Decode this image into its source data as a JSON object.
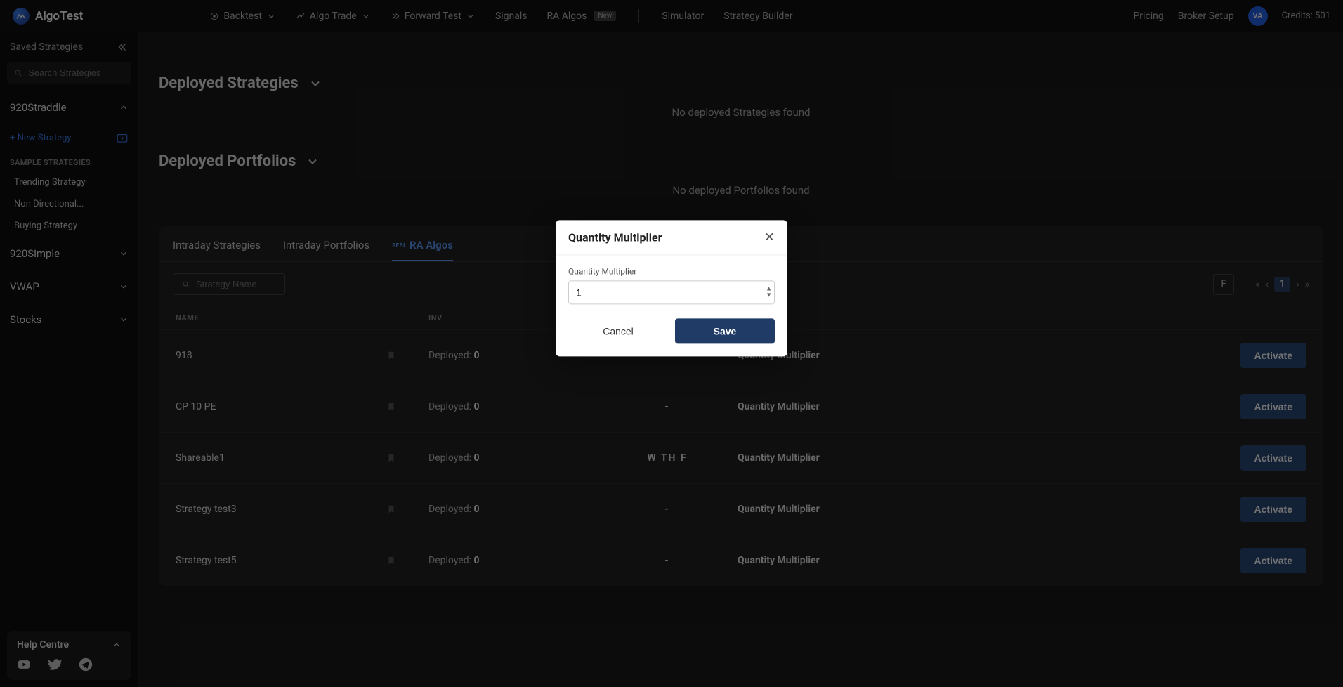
{
  "brand": "AlgoTest",
  "nav": {
    "backtest": "Backtest",
    "algo_trade": "Algo Trade",
    "forward_test": "Forward Test",
    "signals": "Signals",
    "ra_algos": "RA Algos",
    "ra_new": "New",
    "simulator": "Simulator",
    "strategy_builder": "Strategy Builder",
    "pricing": "Pricing",
    "broker_setup": "Broker Setup",
    "avatar_initials": "VA",
    "credits_label": "Credits:",
    "credits_value": "501"
  },
  "sidebar": {
    "saved": "Saved Strategies",
    "search_placeholder": "Search Strategies",
    "groups": {
      "g0": "920Straddle",
      "g1": "920Simple",
      "g2": "VWAP",
      "g3": "Stocks"
    },
    "new_strategy": "+ New Strategy",
    "sample_header": "SAMPLE STRATEGIES",
    "sample": {
      "s0": "Trending Strategy",
      "s1": "Non Directional...",
      "s2": "Buying Strategy"
    },
    "help": "Help Centre"
  },
  "sections": {
    "deployed_strategies": "Deployed Strategies",
    "no_strategies": "No deployed Strategies found",
    "deployed_portfolios": "Deployed Portfolios",
    "no_portfolios": "No deployed Portfolios found"
  },
  "tabs": {
    "t0": "Intraday Strategies",
    "t1": "Intraday Portfolios",
    "t2": "RA Algos",
    "sebi": "SEBI"
  },
  "filter": {
    "search_placeholder": "Strategy Name",
    "day": "F",
    "page": "1"
  },
  "table": {
    "col_name": "NAME",
    "col_inv": "INV",
    "deployed_label": "Deployed:",
    "qm_label": "Quantity Multiplier",
    "activate": "Activate",
    "rows": {
      "r0": {
        "name": "918",
        "deployed": "0",
        "days": "-"
      },
      "r1": {
        "name": "CP 10 PE",
        "deployed": "0",
        "days": "-"
      },
      "r2": {
        "name": "Shareable1",
        "deployed": "0",
        "days": "W TH F"
      },
      "r3": {
        "name": "Strategy test3",
        "deployed": "0",
        "days": "-"
      },
      "r4": {
        "name": "Strategy test5",
        "deployed": "0",
        "days": "-"
      }
    }
  },
  "modal": {
    "title": "Quantity Multiplier",
    "label": "Quantity Multiplier",
    "value": "1",
    "cancel": "Cancel",
    "save": "Save"
  }
}
